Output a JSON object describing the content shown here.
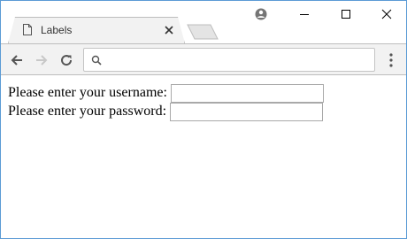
{
  "browser": {
    "tab": {
      "title": "Labels",
      "icon": "document-icon",
      "close_icon": "close-icon"
    },
    "window_controls": {
      "account_icon": "account-circle-icon",
      "minimize_icon": "minimize-icon",
      "maximize_icon": "maximize-icon",
      "close_icon": "close-icon"
    },
    "toolbar": {
      "back_icon": "arrow-left-icon",
      "forward_icon": "arrow-right-icon",
      "reload_icon": "reload-icon",
      "menu_icon": "kebab-menu-icon",
      "omnibox": {
        "search_icon": "search-icon",
        "value": ""
      }
    }
  },
  "page": {
    "username_label": "Please enter your username:",
    "username_value": "",
    "password_label": "Please enter your password:",
    "password_value": ""
  },
  "colors": {
    "window_border": "#5b9bd5",
    "chrome_bg": "#f2f2f2",
    "page_bg": "#ffffff"
  }
}
